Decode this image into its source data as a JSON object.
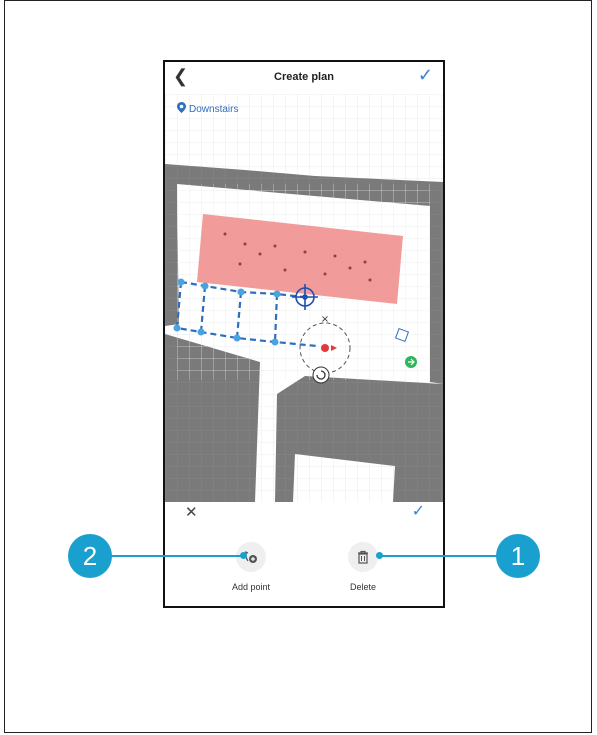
{
  "header": {
    "title": "Create plan",
    "back_icon": "chevron-left-icon",
    "confirm_icon": "check-icon"
  },
  "map": {
    "location_label": "Downstairs",
    "location_icon": "location-pin-icon"
  },
  "bottom_bar": {
    "cancel_icon": "close-icon",
    "confirm_icon": "check-icon"
  },
  "actions": [
    {
      "label": "Add point",
      "icon": "add-point-icon"
    },
    {
      "label": "Delete",
      "icon": "trash-icon"
    }
  ],
  "callouts": [
    {
      "number": "2"
    },
    {
      "number": "1"
    }
  ],
  "colors": {
    "accent": "#3b82d6",
    "callout": "#1aa0cf",
    "no_go_zone": "#f08a8a",
    "path": "#2e6dbf"
  }
}
